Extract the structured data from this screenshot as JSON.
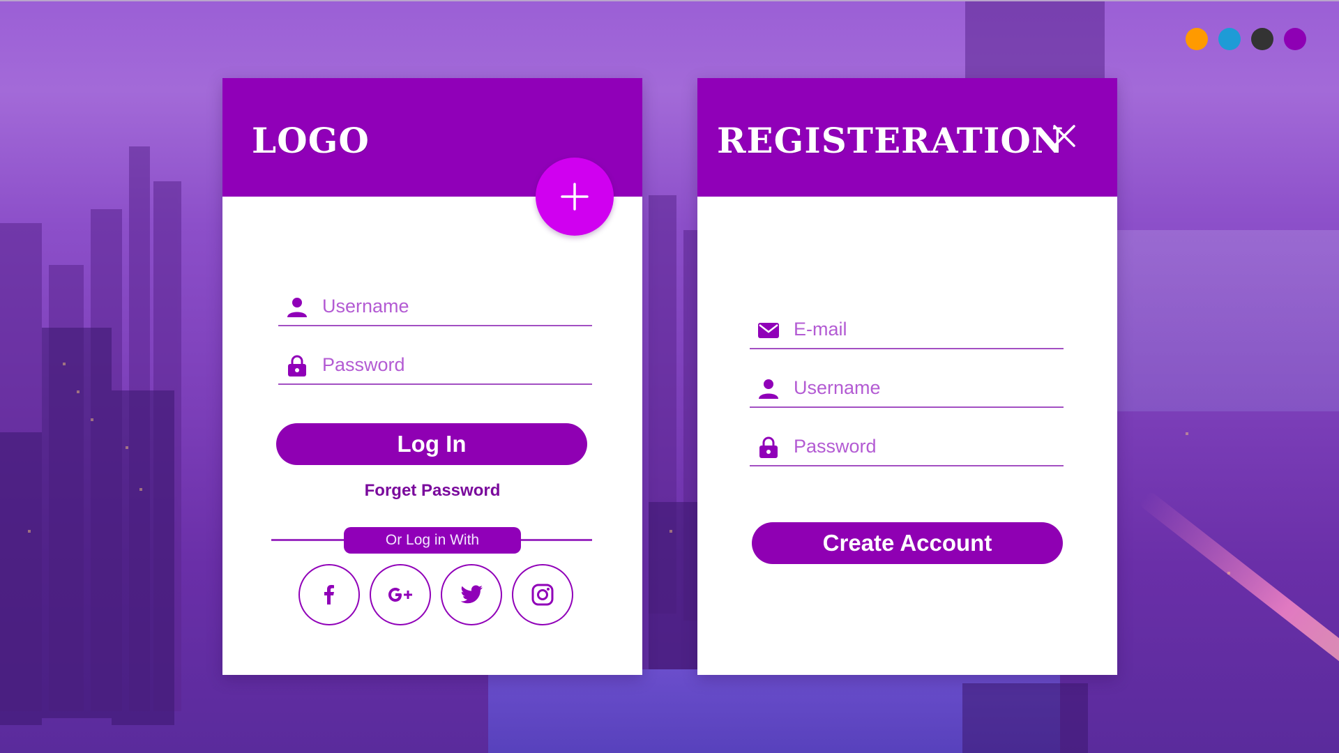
{
  "theme": {
    "accent": "#9000B8",
    "accent_bright": "#D000F0",
    "field_line": "#A24FC2",
    "placeholder": "#B35BD3"
  },
  "color_picker": {
    "swatches": [
      "#FF9A00",
      "#1E9BD6",
      "#333333",
      "#8E00B4"
    ]
  },
  "login": {
    "title": "LOGO",
    "username_placeholder": "Username",
    "password_placeholder": "Password",
    "login_label": "Log In",
    "forgot_label": "Forget Password",
    "divider_label": "Or Log in With",
    "socials": [
      "facebook-icon",
      "google-plus-icon",
      "twitter-icon",
      "instagram-icon"
    ]
  },
  "register": {
    "title": "REGISTERATION",
    "email_placeholder": "E-mail",
    "username_placeholder": "Username",
    "password_placeholder": "Password",
    "create_label": "Create Account"
  }
}
